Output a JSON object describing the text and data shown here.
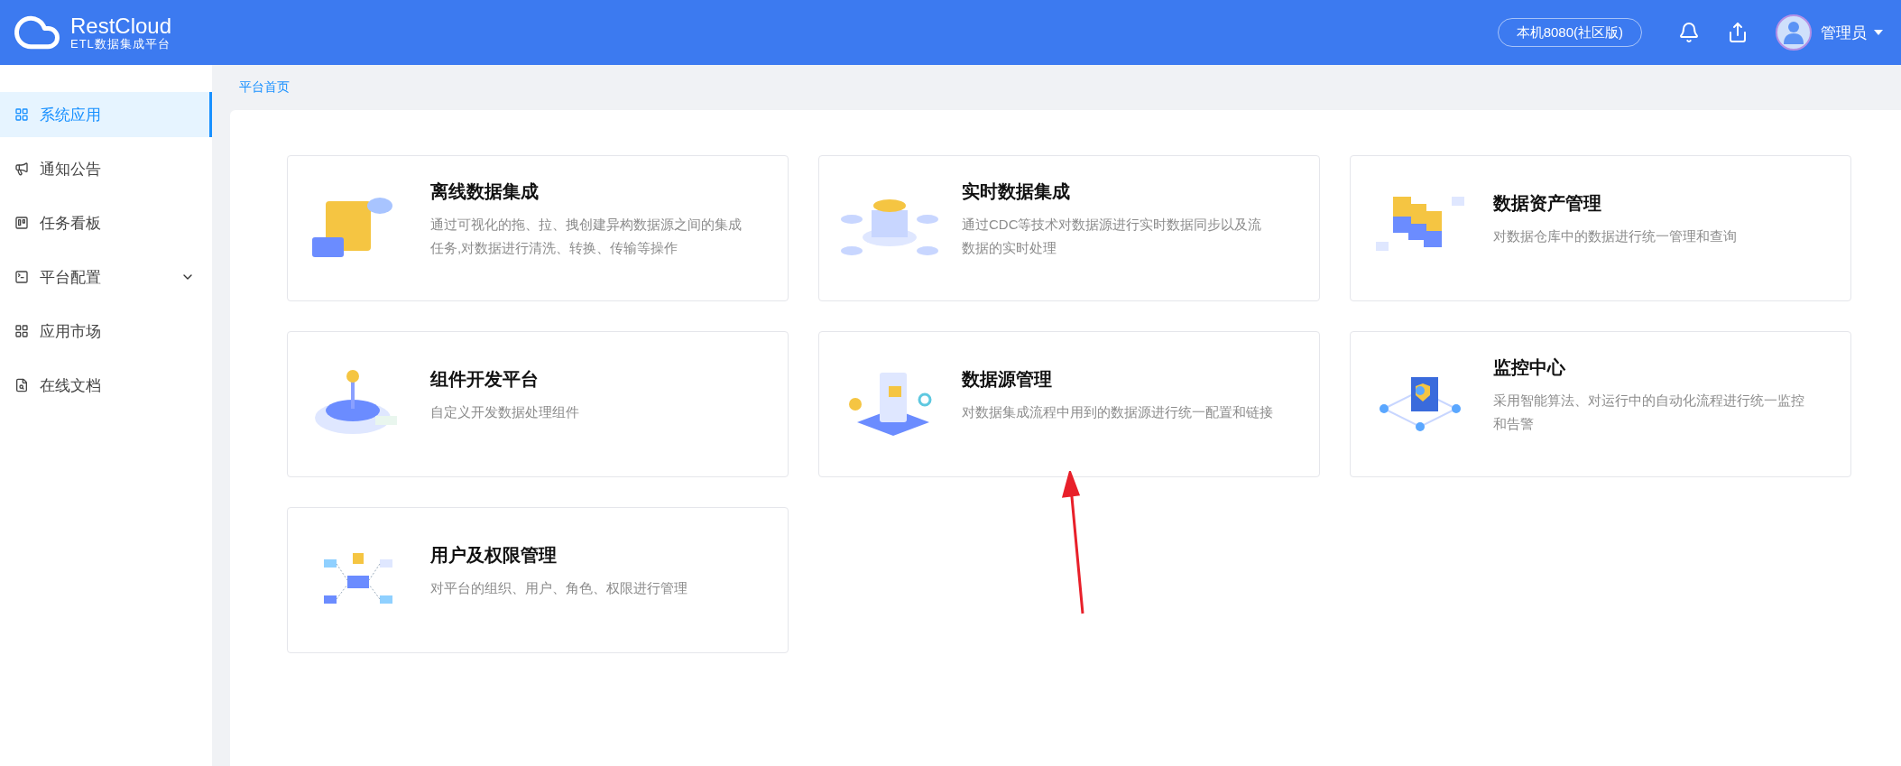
{
  "header": {
    "logo_title": "RestCloud",
    "logo_subtitle": "ETL数据集成平台",
    "server": "本机8080(社区版)",
    "user": "管理员"
  },
  "sidebar": {
    "items": [
      {
        "label": "系统应用",
        "selected": true,
        "kind": "link"
      },
      {
        "label": "通知公告",
        "selected": false,
        "kind": "link"
      },
      {
        "label": "任务看板",
        "selected": false,
        "kind": "link"
      },
      {
        "label": "平台配置",
        "selected": false,
        "kind": "group"
      },
      {
        "label": "应用市场",
        "selected": false,
        "kind": "link"
      },
      {
        "label": "在线文档",
        "selected": false,
        "kind": "link"
      }
    ]
  },
  "breadcrumb": "平台首页",
  "cards": [
    {
      "title": "离线数据集成",
      "description": "通过可视化的拖、拉、拽创建异构数据源之间的集成任务,对数据进行清洗、转换、传输等操作"
    },
    {
      "title": "实时数据集成",
      "description": "通过CDC等技术对数据源进行实时数据同步以及流数据的实时处理"
    },
    {
      "title": "数据资产管理",
      "description": "对数据仓库中的数据进行统一管理和查询"
    },
    {
      "title": "组件开发平台",
      "description": "自定义开发数据处理组件"
    },
    {
      "title": "数据源管理",
      "description": "对数据集成流程中用到的数据源进行统一配置和链接"
    },
    {
      "title": "监控中心",
      "description": "采用智能算法、对运行中的自动化流程进行统一监控和告警"
    },
    {
      "title": "用户及权限管理",
      "description": "对平台的组织、用户、角色、权限进行管理"
    }
  ]
}
